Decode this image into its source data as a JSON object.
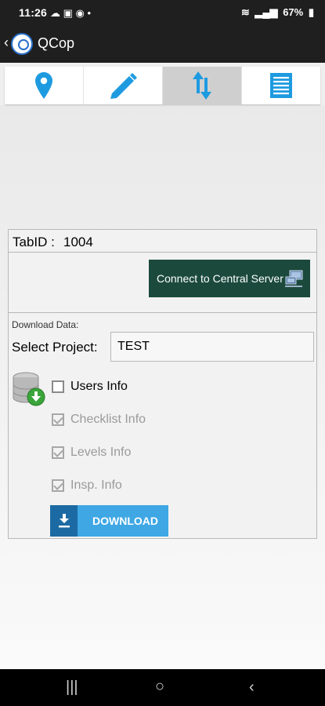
{
  "status_bar": {
    "time": "11:26",
    "notifications": "☁ ▣ ◉ •",
    "battery": "67%"
  },
  "app_bar": {
    "title": "QCop"
  },
  "tabs": [
    {
      "icon": "location-pin-icon",
      "active": false
    },
    {
      "icon": "pencil-icon",
      "active": false
    },
    {
      "icon": "sync-arrows-icon",
      "active": true
    },
    {
      "icon": "list-icon",
      "active": false
    }
  ],
  "panel": {
    "tabid_label": "TabID :",
    "tabid_value": "1004",
    "connect_button": "Connect to Central Server",
    "download_data_label": "Download Data:",
    "select_project_label": "Select Project:",
    "project_value": "TEST",
    "checkboxes": [
      {
        "label": "Users Info",
        "checked": false,
        "enabled": true
      },
      {
        "label": "Checklist Info",
        "checked": true,
        "enabled": false
      },
      {
        "label": "Levels Info",
        "checked": true,
        "enabled": false
      },
      {
        "label": "Insp. Info",
        "checked": true,
        "enabled": false
      }
    ],
    "download_button": "DOWNLOAD"
  },
  "colors": {
    "accent_blue": "#1e9be0",
    "connect_green": "#1b4a3d",
    "download_blue": "#3ea7e4"
  }
}
